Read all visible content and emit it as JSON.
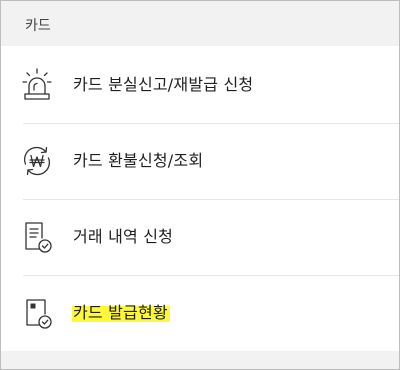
{
  "section": {
    "title": "카드"
  },
  "menu": {
    "items": [
      {
        "label": "카드 분실신고/재발급 신청",
        "icon": "siren-icon",
        "highlighted": false
      },
      {
        "label": "카드 환불신청/조회",
        "icon": "won-refund-icon",
        "highlighted": false
      },
      {
        "label": "거래 내역 신청",
        "icon": "document-check-icon",
        "highlighted": false
      },
      {
        "label": "카드 발급현황",
        "icon": "card-status-check-icon",
        "highlighted": true
      }
    ]
  },
  "colors": {
    "header_bg": "#f2f2f2",
    "highlight": "#fff83a",
    "icon_stroke": "#333333",
    "divider": "#e6e6e6"
  }
}
